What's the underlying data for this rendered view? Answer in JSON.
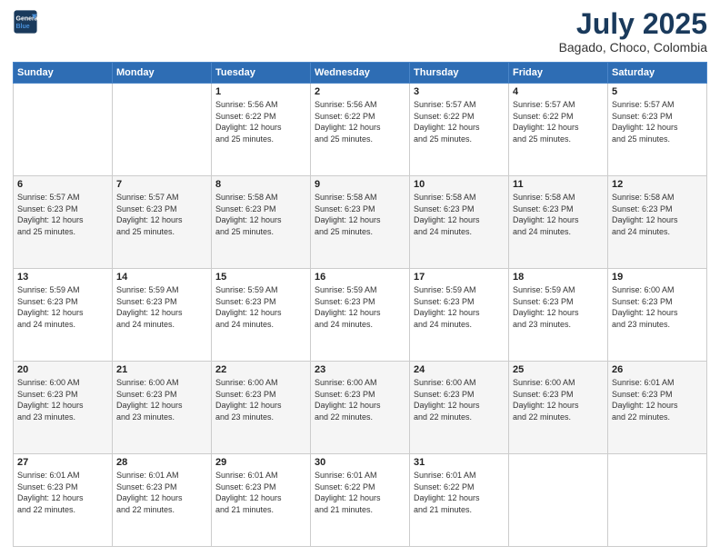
{
  "logo": {
    "line1": "General",
    "line2": "Blue"
  },
  "header": {
    "month_year": "July 2025",
    "location": "Bagado, Choco, Colombia"
  },
  "weekdays": [
    "Sunday",
    "Monday",
    "Tuesday",
    "Wednesday",
    "Thursday",
    "Friday",
    "Saturday"
  ],
  "weeks": [
    [
      {
        "day": "",
        "info": ""
      },
      {
        "day": "",
        "info": ""
      },
      {
        "day": "1",
        "info": "Sunrise: 5:56 AM\nSunset: 6:22 PM\nDaylight: 12 hours\nand 25 minutes."
      },
      {
        "day": "2",
        "info": "Sunrise: 5:56 AM\nSunset: 6:22 PM\nDaylight: 12 hours\nand 25 minutes."
      },
      {
        "day": "3",
        "info": "Sunrise: 5:57 AM\nSunset: 6:22 PM\nDaylight: 12 hours\nand 25 minutes."
      },
      {
        "day": "4",
        "info": "Sunrise: 5:57 AM\nSunset: 6:22 PM\nDaylight: 12 hours\nand 25 minutes."
      },
      {
        "day": "5",
        "info": "Sunrise: 5:57 AM\nSunset: 6:23 PM\nDaylight: 12 hours\nand 25 minutes."
      }
    ],
    [
      {
        "day": "6",
        "info": "Sunrise: 5:57 AM\nSunset: 6:23 PM\nDaylight: 12 hours\nand 25 minutes."
      },
      {
        "day": "7",
        "info": "Sunrise: 5:57 AM\nSunset: 6:23 PM\nDaylight: 12 hours\nand 25 minutes."
      },
      {
        "day": "8",
        "info": "Sunrise: 5:58 AM\nSunset: 6:23 PM\nDaylight: 12 hours\nand 25 minutes."
      },
      {
        "day": "9",
        "info": "Sunrise: 5:58 AM\nSunset: 6:23 PM\nDaylight: 12 hours\nand 25 minutes."
      },
      {
        "day": "10",
        "info": "Sunrise: 5:58 AM\nSunset: 6:23 PM\nDaylight: 12 hours\nand 24 minutes."
      },
      {
        "day": "11",
        "info": "Sunrise: 5:58 AM\nSunset: 6:23 PM\nDaylight: 12 hours\nand 24 minutes."
      },
      {
        "day": "12",
        "info": "Sunrise: 5:58 AM\nSunset: 6:23 PM\nDaylight: 12 hours\nand 24 minutes."
      }
    ],
    [
      {
        "day": "13",
        "info": "Sunrise: 5:59 AM\nSunset: 6:23 PM\nDaylight: 12 hours\nand 24 minutes."
      },
      {
        "day": "14",
        "info": "Sunrise: 5:59 AM\nSunset: 6:23 PM\nDaylight: 12 hours\nand 24 minutes."
      },
      {
        "day": "15",
        "info": "Sunrise: 5:59 AM\nSunset: 6:23 PM\nDaylight: 12 hours\nand 24 minutes."
      },
      {
        "day": "16",
        "info": "Sunrise: 5:59 AM\nSunset: 6:23 PM\nDaylight: 12 hours\nand 24 minutes."
      },
      {
        "day": "17",
        "info": "Sunrise: 5:59 AM\nSunset: 6:23 PM\nDaylight: 12 hours\nand 24 minutes."
      },
      {
        "day": "18",
        "info": "Sunrise: 5:59 AM\nSunset: 6:23 PM\nDaylight: 12 hours\nand 23 minutes."
      },
      {
        "day": "19",
        "info": "Sunrise: 6:00 AM\nSunset: 6:23 PM\nDaylight: 12 hours\nand 23 minutes."
      }
    ],
    [
      {
        "day": "20",
        "info": "Sunrise: 6:00 AM\nSunset: 6:23 PM\nDaylight: 12 hours\nand 23 minutes."
      },
      {
        "day": "21",
        "info": "Sunrise: 6:00 AM\nSunset: 6:23 PM\nDaylight: 12 hours\nand 23 minutes."
      },
      {
        "day": "22",
        "info": "Sunrise: 6:00 AM\nSunset: 6:23 PM\nDaylight: 12 hours\nand 23 minutes."
      },
      {
        "day": "23",
        "info": "Sunrise: 6:00 AM\nSunset: 6:23 PM\nDaylight: 12 hours\nand 22 minutes."
      },
      {
        "day": "24",
        "info": "Sunrise: 6:00 AM\nSunset: 6:23 PM\nDaylight: 12 hours\nand 22 minutes."
      },
      {
        "day": "25",
        "info": "Sunrise: 6:00 AM\nSunset: 6:23 PM\nDaylight: 12 hours\nand 22 minutes."
      },
      {
        "day": "26",
        "info": "Sunrise: 6:01 AM\nSunset: 6:23 PM\nDaylight: 12 hours\nand 22 minutes."
      }
    ],
    [
      {
        "day": "27",
        "info": "Sunrise: 6:01 AM\nSunset: 6:23 PM\nDaylight: 12 hours\nand 22 minutes."
      },
      {
        "day": "28",
        "info": "Sunrise: 6:01 AM\nSunset: 6:23 PM\nDaylight: 12 hours\nand 22 minutes."
      },
      {
        "day": "29",
        "info": "Sunrise: 6:01 AM\nSunset: 6:23 PM\nDaylight: 12 hours\nand 21 minutes."
      },
      {
        "day": "30",
        "info": "Sunrise: 6:01 AM\nSunset: 6:22 PM\nDaylight: 12 hours\nand 21 minutes."
      },
      {
        "day": "31",
        "info": "Sunrise: 6:01 AM\nSunset: 6:22 PM\nDaylight: 12 hours\nand 21 minutes."
      },
      {
        "day": "",
        "info": ""
      },
      {
        "day": "",
        "info": ""
      }
    ]
  ]
}
